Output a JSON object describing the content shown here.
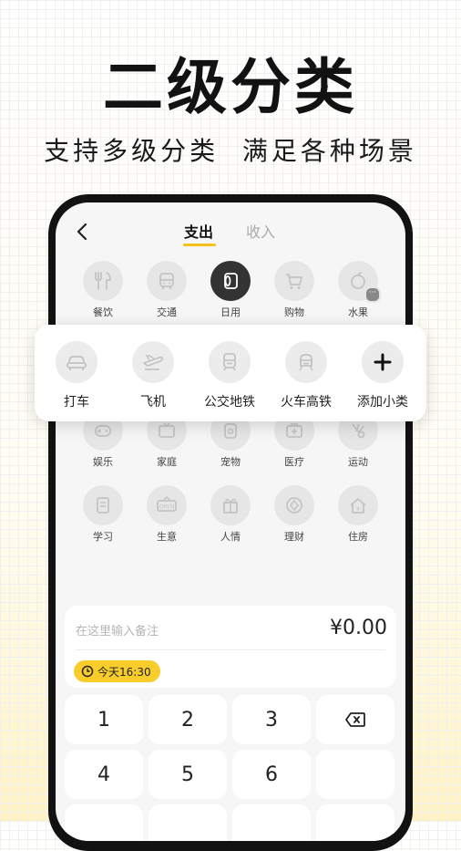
{
  "headline": "二级分类",
  "subtitle": "支持多级分类  满足各种场景",
  "tabs": {
    "expense": "支出",
    "income": "收入"
  },
  "categories": {
    "row1": [
      "餐饮",
      "交通",
      "日用",
      "购物",
      "水果"
    ],
    "row3": [
      "娱乐",
      "家庭",
      "宠物",
      "医疗",
      "运动"
    ],
    "row4": [
      "学习",
      "生意",
      "人情",
      "理财",
      "住房"
    ]
  },
  "subcategories": [
    "打车",
    "飞机",
    "公交地铁",
    "火车高铁",
    "添加小类"
  ],
  "note": {
    "placeholder": "在这里输入备注",
    "amount": "¥0.00",
    "date": "今天16:30"
  },
  "keypad": [
    "1",
    "2",
    "3",
    "4",
    "5",
    "6"
  ],
  "colors": {
    "accent": "#f7cc2b",
    "selected_icon": "#333333"
  },
  "icons": {
    "row1": [
      "utensils-icon",
      "bus-icon",
      "tissue-icon",
      "cart-icon",
      "apple-icon"
    ],
    "sub": [
      "car-icon",
      "plane-icon",
      "subway-icon",
      "train-icon",
      "plus-icon"
    ]
  }
}
